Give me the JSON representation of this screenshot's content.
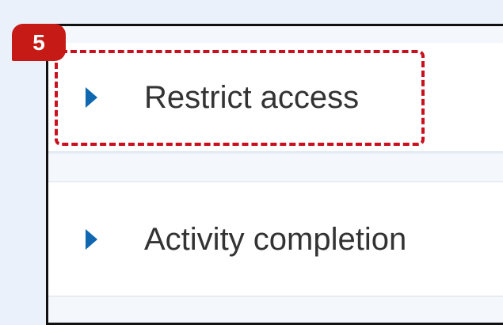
{
  "badge": {
    "number": "5"
  },
  "sections": [
    {
      "label": "Restrict access",
      "icon": "chevron-right-icon"
    },
    {
      "label": "Activity completion",
      "icon": "chevron-right-icon"
    }
  ],
  "colors": {
    "page_background": "#eaf1fa",
    "badge_background": "#c61a16",
    "highlight_dash": "#c8101e",
    "chevron": "#0f67b0",
    "text": "#333333"
  }
}
